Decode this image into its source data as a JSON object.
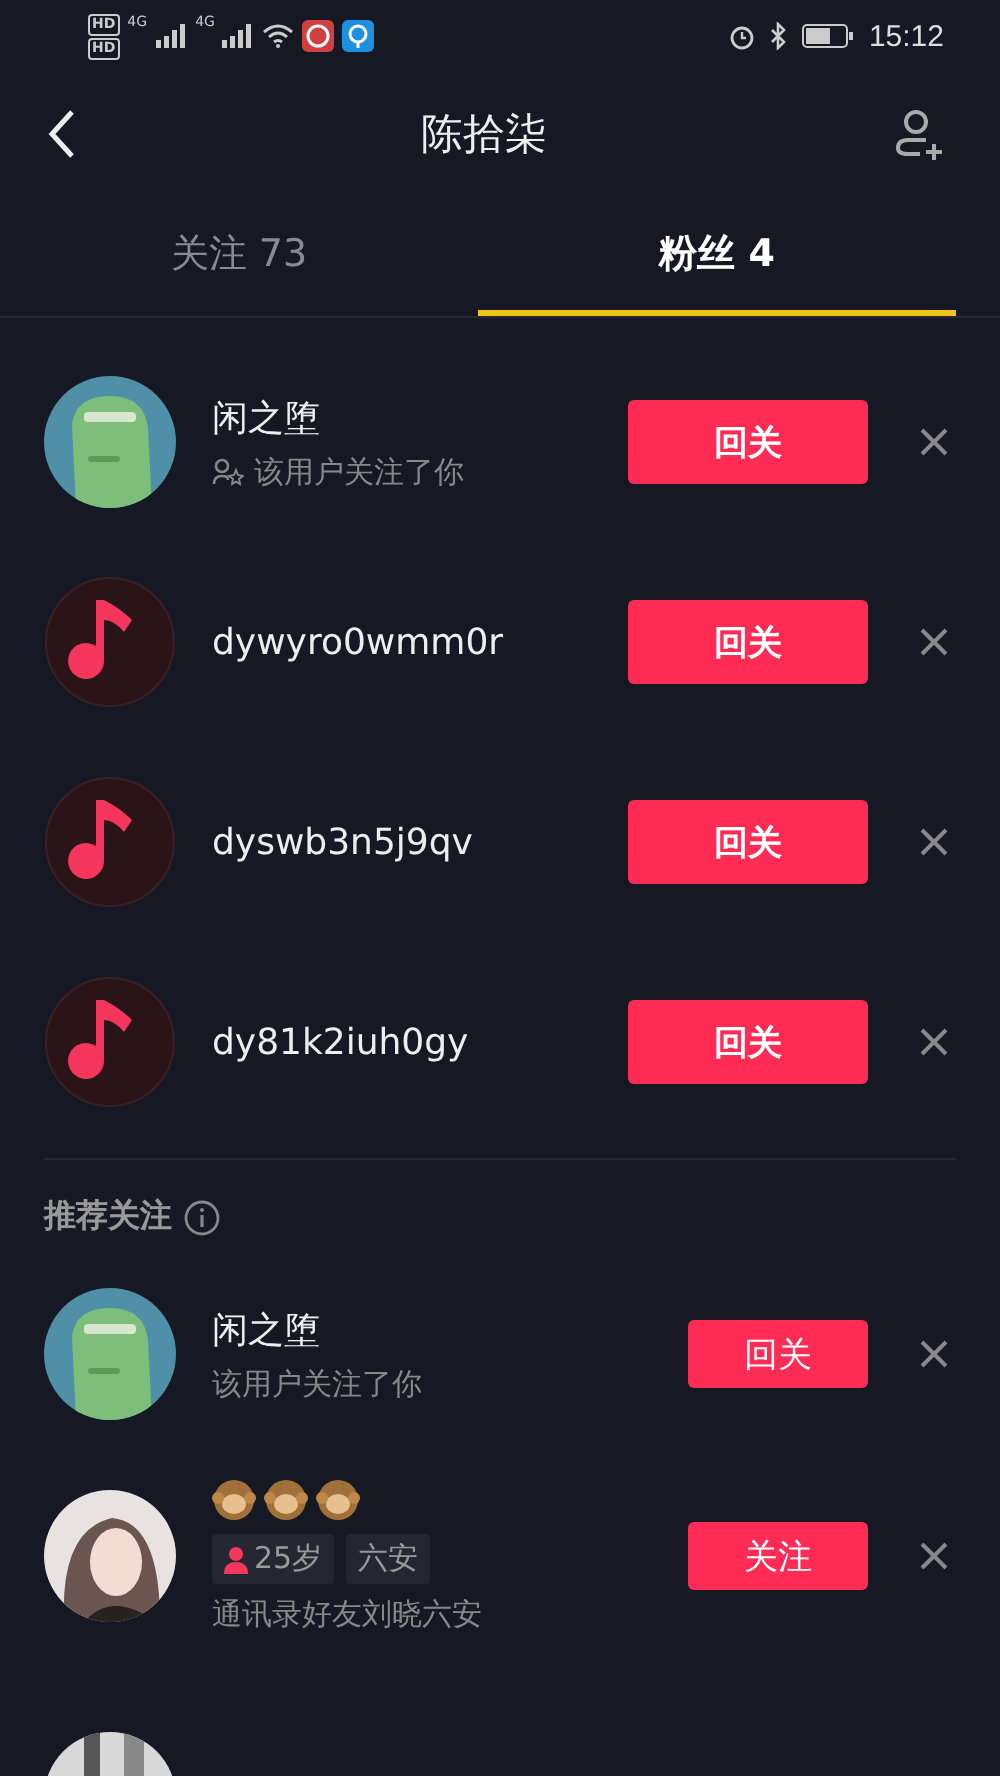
{
  "status_bar": {
    "hd_labels": [
      "HD",
      "HD"
    ],
    "networks": [
      "4G",
      "4G"
    ],
    "time": "15:12"
  },
  "header": {
    "title": "陈拾柒"
  },
  "tabs": [
    {
      "label": "关注 73",
      "selected": false
    },
    {
      "label": "粉丝 4",
      "selected": true
    }
  ],
  "fans": [
    {
      "name": "闲之堕",
      "avatar": {
        "kind": "picture"
      },
      "subtitle": "该用户关注了你",
      "button": "回关"
    },
    {
      "name": "dywyro0wmm0r",
      "avatar": {
        "kind": "note"
      },
      "button": "回关"
    },
    {
      "name": "dyswb3n5j9qv",
      "avatar": {
        "kind": "note"
      },
      "button": "回关"
    },
    {
      "name": "dy81k2iuh0gy",
      "avatar": {
        "kind": "note"
      },
      "button": "回关"
    }
  ],
  "recommended": {
    "title": "推荐关注",
    "users": [
      {
        "name": "闲之堕",
        "avatar": {
          "kind": "picture"
        },
        "subtitle": "该用户关注了你",
        "button": "回关"
      },
      {
        "avatar": {
          "kind": "picture"
        },
        "name_icons": [
          {
            "kind": "monkey"
          },
          {
            "kind": "monkey"
          },
          {
            "kind": "monkey"
          }
        ],
        "tags": [
          {
            "kind": "age",
            "text": "25岁"
          },
          {
            "kind": "place",
            "text": "六安"
          }
        ],
        "subtitle": "通讯录好友刘晓六安",
        "button": "关注"
      },
      {
        "avatar": {
          "kind": "picture"
        }
      }
    ]
  }
}
